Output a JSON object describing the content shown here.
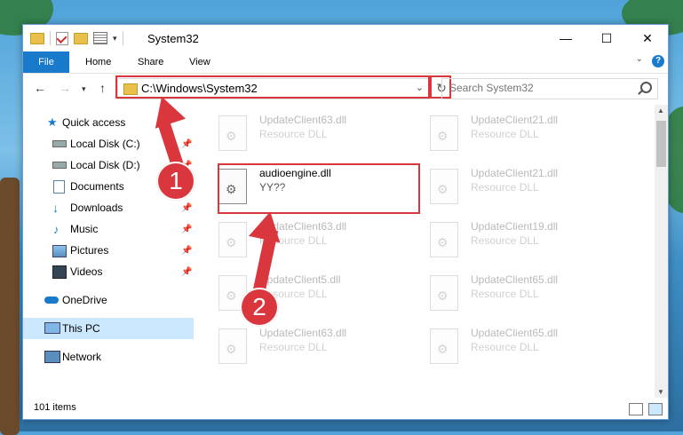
{
  "window": {
    "title": "System32"
  },
  "ribbon": {
    "tabs": [
      "File",
      "Home",
      "Share",
      "View"
    ],
    "help": "?"
  },
  "address": {
    "path": "C:\\Windows\\System32"
  },
  "search": {
    "placeholder": "Search System32"
  },
  "sidebar": {
    "items": [
      {
        "label": "Quick access",
        "icon": "star-icon",
        "pinned": false
      },
      {
        "label": "Local Disk (C:)",
        "icon": "drive-icon",
        "pinned": true
      },
      {
        "label": "Local Disk (D:)",
        "icon": "drive-icon",
        "pinned": true
      },
      {
        "label": "Documents",
        "icon": "documents-icon",
        "pinned": true
      },
      {
        "label": "Downloads",
        "icon": "download-icon",
        "pinned": true
      },
      {
        "label": "Music",
        "icon": "music-icon",
        "pinned": true
      },
      {
        "label": "Pictures",
        "icon": "pictures-icon",
        "pinned": true
      },
      {
        "label": "Videos",
        "icon": "videos-icon",
        "pinned": true
      },
      {
        "label": "OneDrive",
        "icon": "cloud-icon",
        "pinned": false
      },
      {
        "label": "This PC",
        "icon": "computer-icon",
        "pinned": false,
        "selected": true
      },
      {
        "label": "Network",
        "icon": "network-icon",
        "pinned": false
      }
    ]
  },
  "files": {
    "highlighted": {
      "name": "audioengine.dll",
      "type": "YY??"
    },
    "left_column": [
      {
        "name": "UpdateClient63.dll",
        "type": "Resource DLL"
      },
      {
        "name": "UpdateClient63.dll",
        "type": "Resource DLL"
      },
      {
        "name": "UpdateClient5.dll",
        "type": "Resource DLL"
      },
      {
        "name": "UpdateClient63.dll",
        "type": "Resource DLL"
      }
    ],
    "right_column": [
      {
        "name": "UpdateClient21.dll",
        "type": "Resource DLL"
      },
      {
        "name": "UpdateClient21.dll",
        "type": "Resource DLL"
      },
      {
        "name": "UpdateClient19.dll",
        "type": "Resource DLL"
      },
      {
        "name": "UpdateClient65.dll",
        "type": "Resource DLL"
      },
      {
        "name": "UpdateClient65.dll",
        "type": "Resource DLL"
      }
    ]
  },
  "status": {
    "count": "101 items"
  },
  "annotations": {
    "badge1": "1",
    "badge2": "2",
    "color": "#d9363e"
  }
}
